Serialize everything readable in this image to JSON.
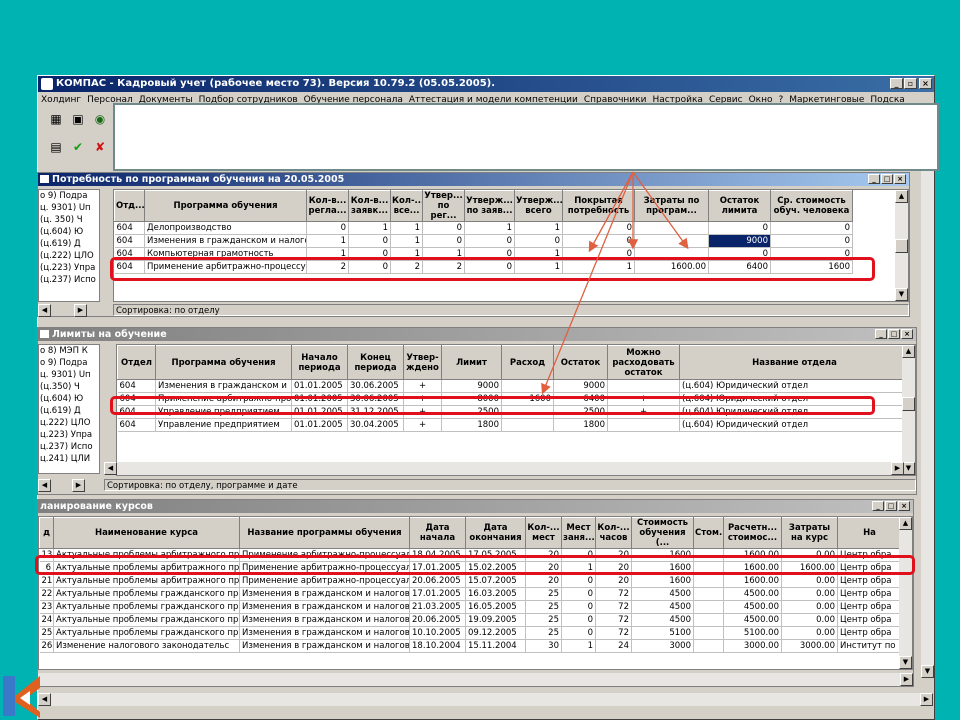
{
  "app": {
    "title": "КОМПАС - Кадровый учет (рабочее место 73). Версия 10.79.2 (05.05.2005).",
    "menu": [
      "Холдинг",
      "Персонал",
      "Документы",
      "Подбор сотрудников",
      "Обучение персонала",
      "Аттестация и модели компетенции",
      "Справочники",
      "Настройка",
      "Сервис",
      "Окно",
      "?",
      "Маркетинговые",
      "Подска"
    ],
    "toolbar_icons": [
      "calculator-icon",
      "calendar-icon",
      "globe-icon",
      "form-icon",
      "check-icon",
      "cross-icon"
    ]
  },
  "need": {
    "title": "Потребность по программам обучения на 20.05.2005",
    "tree": [
      "о 9) Подра",
      "ц. 9301) Uп",
      "(ц. 350) Ч",
      "(ц.604) Ю",
      "(ц.619) Д",
      "(ц.222) ЦЛО",
      "(ц.223) Упра",
      "(ц.237) Испо"
    ],
    "headers": [
      "Отд...",
      "Программа обучения",
      "Кол-в... регла...",
      "Кол-в... заявк...",
      "Кол-... все...",
      "Утвер... по рег...",
      "Утверж... по заяв...",
      "Утверж... всего",
      "Покрытая потребность",
      "Затраты по програм...",
      "Остаток лимита",
      "Ср. стоимость обуч. человека"
    ],
    "rows": [
      [
        "604",
        "Делопроизводство",
        "0",
        "1",
        "1",
        "0",
        "1",
        "1",
        "0",
        "",
        "0",
        "0"
      ],
      [
        "604",
        "Изменения в гражданском и налого",
        "1",
        "0",
        "1",
        "0",
        "0",
        "0",
        "0",
        "",
        "9000",
        "0"
      ],
      [
        "604",
        "Компьютерная грамотность",
        "1",
        "0",
        "1",
        "1",
        "0",
        "1",
        "0",
        "",
        "0",
        "0"
      ],
      [
        "604",
        "Применение арбитражно-процессуа",
        "2",
        "0",
        "2",
        "2",
        "0",
        "1",
        "1",
        "1600.00",
        "6400",
        "1600"
      ]
    ],
    "status": "Сортировка: по отделу"
  },
  "limits": {
    "title": "Лимиты на обучение",
    "tree": [
      "о 8) МЭП К",
      "о 9) Подра",
      "ц. 9301) Uп",
      "(ц.350) Ч",
      "(ц.604) Ю",
      "(ц.619) Д",
      "ц.222) ЦЛО",
      "ц.223) Упра",
      "ц.237) Испо",
      "ц.241) ЦЛИ"
    ],
    "headers": [
      "Отдел",
      "Программа обучения",
      "Начало периода",
      "Конец периода",
      "Утвер- ждено",
      "Лимит",
      "Расход",
      "Остаток",
      "Можно расходовать остаток",
      "Название отдела"
    ],
    "rows": [
      [
        "604",
        "Изменения в гражданском и",
        "01.01.2005",
        "30.06.2005",
        "+",
        "9000",
        "",
        "9000",
        "",
        "(ц.604) Юридический отдел"
      ],
      [
        "604",
        "Применение арбитражно-проц",
        "01.01.2005",
        "30.06.2005",
        "+",
        "8000",
        "1600",
        "6400",
        "+",
        "(ц.604) Юридический отдел"
      ],
      [
        "604",
        "Управление предприятием",
        "01.01.2005",
        "31.12.2005",
        "+",
        "2500",
        "",
        "2500",
        "+",
        "(ц.604) Юридический отдел"
      ],
      [
        "604",
        "Управление предприятием",
        "01.01.2005",
        "30.04.2005",
        "+",
        "1800",
        "",
        "1800",
        "",
        "(ц.604) Юридический отдел"
      ]
    ],
    "status": "Сортировка: по отделу, программе и дате"
  },
  "courses": {
    "title": "ланирование курсов",
    "headers": [
      "д",
      "Наименование курса",
      "Название программы обучения",
      "Дата начала",
      "Дата окончания",
      "Кол-... мест",
      "Мест заня...",
      "Кол-... часов",
      "Стоимость обучения (...",
      "Стом.",
      "Расчетн... стоимос...",
      "Затраты на курс",
      "На"
    ],
    "rows": [
      [
        "13",
        "Актуальные проблемы арбитражного пр",
        "Применение арбитражно-процессуал",
        "18.04.2005",
        "17.05.2005",
        "20",
        "0",
        "20",
        "1600",
        "",
        "1600.00",
        "0.00",
        "Центр обра"
      ],
      [
        "6",
        "Актуальные проблемы арбитражного пр",
        "Применение арбитражно-процессуал",
        "17.01.2005",
        "15.02.2005",
        "20",
        "1",
        "20",
        "1600",
        "",
        "1600.00",
        "1600.00",
        "Центр обра"
      ],
      [
        "21",
        "Актуальные проблемы арбитражного пр",
        "Применение арбитражно-процессуал",
        "20.06.2005",
        "15.07.2005",
        "20",
        "0",
        "20",
        "1600",
        "",
        "1600.00",
        "0.00",
        "Центр обра"
      ],
      [
        "22",
        "Актуальные проблемы гражданского пр",
        "Изменения в гражданском и налогов",
        "17.01.2005",
        "16.03.2005",
        "25",
        "0",
        "72",
        "4500",
        "",
        "4500.00",
        "0.00",
        "Центр обра"
      ],
      [
        "23",
        "Актуальные проблемы гражданского пр",
        "Изменения в гражданском и налогов",
        "21.03.2005",
        "16.05.2005",
        "25",
        "0",
        "72",
        "4500",
        "",
        "4500.00",
        "0.00",
        "Центр обра"
      ],
      [
        "24",
        "Актуальные проблемы гражданского пр",
        "Изменения в гражданском и налогов",
        "20.06.2005",
        "19.09.2005",
        "25",
        "0",
        "72",
        "4500",
        "",
        "4500.00",
        "0.00",
        "Центр обра"
      ],
      [
        "25",
        "Актуальные проблемы гражданского пр",
        "Изменения в гражданском и налогов",
        "10.10.2005",
        "09.12.2005",
        "25",
        "0",
        "72",
        "5100",
        "",
        "5100.00",
        "0.00",
        "Центр обра"
      ],
      [
        "26",
        "Изменение налогового законодательс",
        "Изменения в гражданском и налогов",
        "18.10.2004",
        "15.11.2004",
        "30",
        "1",
        "24",
        "3000",
        "",
        "3000.00",
        "3000.00",
        "Институт по"
      ]
    ]
  },
  "colors": {
    "background": "#00b3b3",
    "highlight": "#e0101c",
    "title_active": "#0a246a"
  }
}
